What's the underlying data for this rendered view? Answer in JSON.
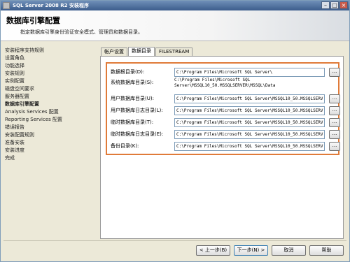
{
  "window": {
    "title": "SQL Server 2008 R2 安装程序",
    "min_label": "–",
    "max_label": "□",
    "close_label": "×"
  },
  "header": {
    "title": "数据库引擎配置",
    "description": "指定数据库引擎身份验证安全模式、管理员和数据目录。"
  },
  "nav": {
    "items": [
      "安装程序支持规则",
      "设置角色",
      "功能选择",
      "安装规则",
      "实例配置",
      "磁盘空间要求",
      "服务器配置",
      "数据库引擎配置",
      "Analysis Services 配置",
      "Reporting Services 配置",
      "错误报告",
      "安装配置规则",
      "准备安装",
      "安装进度",
      "完成"
    ],
    "active_index": 7
  },
  "tabs": [
    "帐户设置",
    "数据目录",
    "FILESTREAM"
  ],
  "active_tab": 1,
  "directories": {
    "data_root_label": "数据根目录(D):",
    "data_root_value": "C:\\Program Files\\Microsoft SQL Server\\",
    "system_db_label": "系统数据库目录(S):",
    "system_db_value_line1": "C:\\Program Files\\Microsoft SQL",
    "system_db_value_line2": "Server\\MSSQL10_50.MSSQLSERVER\\MSSQL\\Data",
    "user_db_label": "用户数据库目录(U):",
    "user_db_value": "C:\\Program Files\\Microsoft SQL Server\\MSSQL10_50.MSSQLSERV",
    "user_log_label": "用户数据库日志目录(L):",
    "user_log_value": "C:\\Program Files\\Microsoft SQL Server\\MSSQL10_50.MSSQLSERV",
    "temp_db_label": "临时数据库目录(T):",
    "temp_db_value": "C:\\Program Files\\Microsoft SQL Server\\MSSQL10_50.MSSQLSERV",
    "temp_log_label": "临时数据库日志目录(E):",
    "temp_log_value": "C:\\Program Files\\Microsoft SQL Server\\MSSQL10_50.MSSQLSERV",
    "backup_label": "备份目录(K):",
    "backup_value": "C:\\Program Files\\Microsoft SQL Server\\MSSQL10_50.MSSQLSERV",
    "browse_label": "..."
  },
  "buttons": {
    "back": "< 上一步(B)",
    "next": "下一步(N) >",
    "cancel": "取消",
    "help": "帮助"
  },
  "colors": {
    "highlight": "#e07b39",
    "titlebar": "#3c5d8c"
  }
}
